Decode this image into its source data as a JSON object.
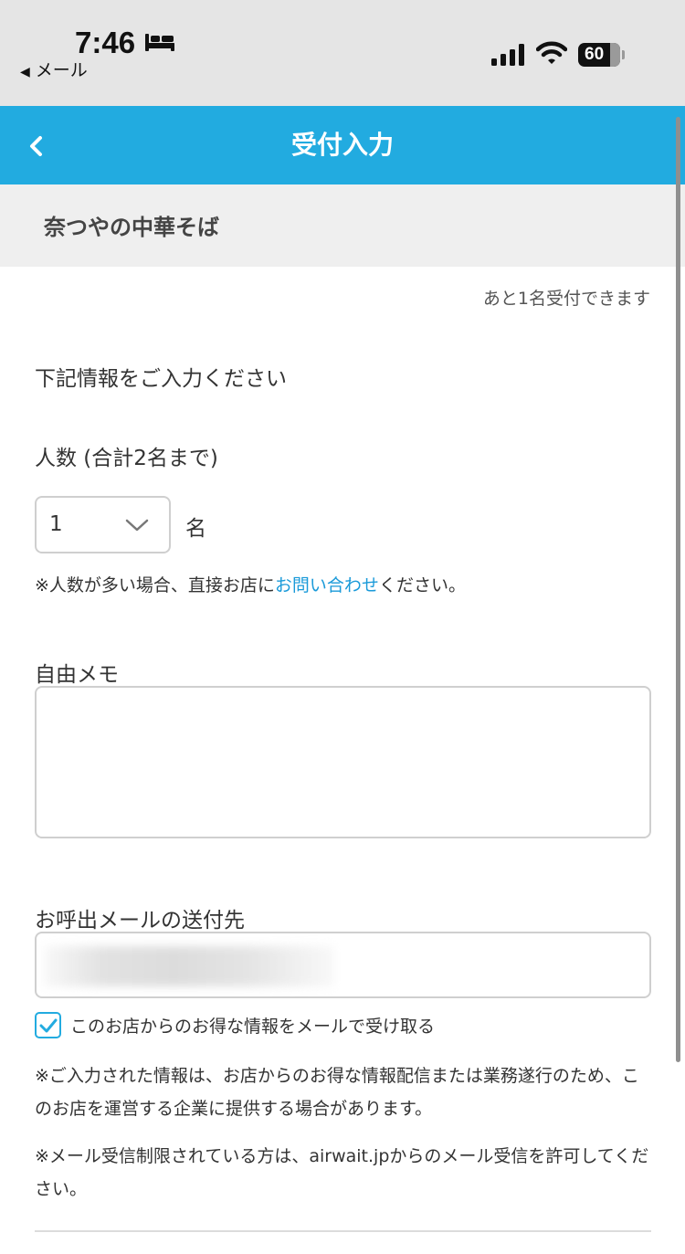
{
  "status_bar": {
    "time": "7:46",
    "back_app": "メール",
    "battery": "60"
  },
  "nav": {
    "title": "受付入力"
  },
  "shop": {
    "name": "奈つやの中華そば"
  },
  "form": {
    "remaining": "あと1名受付できます",
    "intro": "下記情報をご入力ください",
    "people_label": "人数 (合計2名まで)",
    "people_value": "1",
    "people_unit": "名",
    "note_prefix": "※人数が多い場合、直接お店に",
    "note_link": "お問い合わせ",
    "note_suffix": "ください。",
    "memo_label": "自由メモ",
    "mail_label": "お呼出メールの送付先",
    "optin_checked": true,
    "optin_label": "このお店からのお得な情報をメールで受け取る",
    "disclaimer_1": "※ご入力された情報は、お店からのお得な情報配信または業務遂行のため、このお店を運営する企業に提供する場合があります。",
    "disclaimer_2": "※メール受信制限されている方は、airwait.jpからのメール受信を許可してください。"
  },
  "colors": {
    "accent": "#22abe0",
    "link": "#1a9ad9",
    "status_bg": "#e5e5e5",
    "shop_bg": "#efefef"
  }
}
